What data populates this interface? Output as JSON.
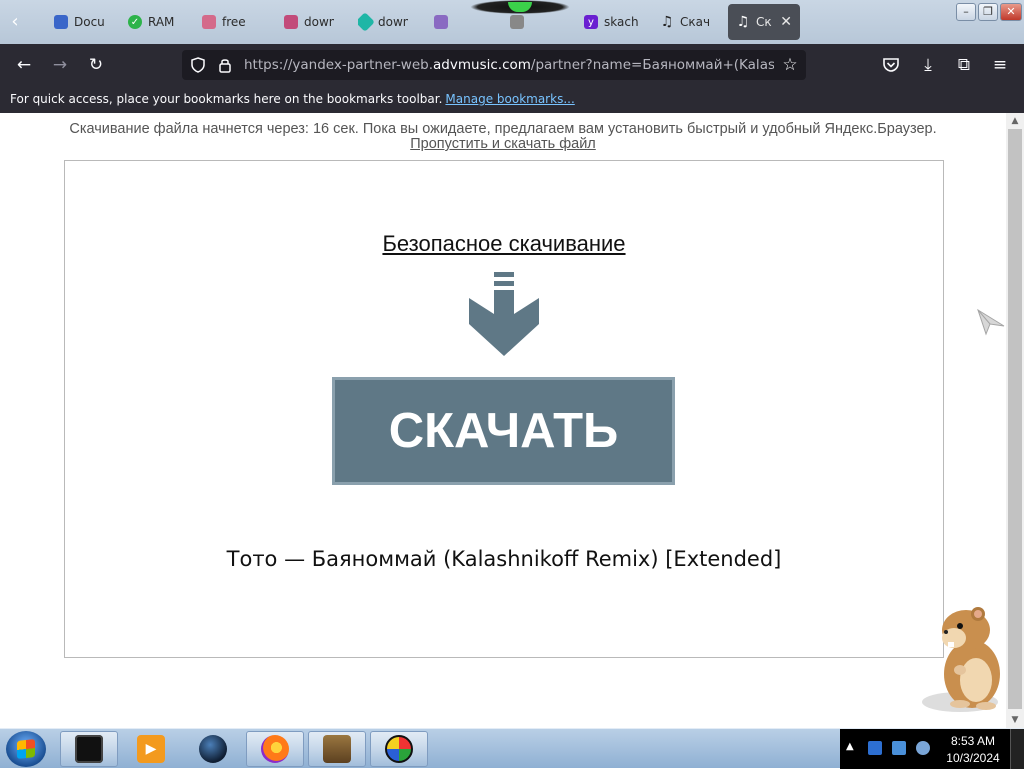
{
  "tabs": [
    {
      "label": "Docu",
      "icon": "document-icon",
      "color": "#3a66c9"
    },
    {
      "label": "RAM",
      "icon": "shield-check-icon",
      "color": "#2db34a"
    },
    {
      "label": "free",
      "icon": "site-icon",
      "color": "#d46a8a"
    },
    {
      "label": "down",
      "icon": "site-icon",
      "color": "#c24b7a"
    },
    {
      "label": "down",
      "icon": "gem-icon",
      "color": "#1fb6a6"
    },
    {
      "label": "",
      "icon": "site-icon",
      "color": "#8a6ac2"
    },
    {
      "label": "",
      "icon": "site-icon",
      "color": "#888888"
    },
    {
      "label": "skach",
      "icon": "yahoo-icon",
      "color": "#6a1fd1"
    },
    {
      "label": "Скач",
      "icon": "music-note-icon",
      "color": "#222222"
    },
    {
      "label": "Ск",
      "icon": "music-note-icon",
      "color": "#222222",
      "active": true
    }
  ],
  "window": {
    "minimize": "–",
    "restore": "❐",
    "close": "✕"
  },
  "nav": {
    "back": "←",
    "forward": "→",
    "reload": "↻",
    "url_prefix": "https://yandex-partner-web.",
    "url_domain": "advmusic.com",
    "url_suffix": "/partner?name=Баяноммай+(Kalashnikoff+",
    "shield": "⛉",
    "lock": "🔒",
    "star": "☆",
    "pocket": "⛉",
    "downloads": "⤓",
    "extensions": "⧉",
    "menu": "≡"
  },
  "bookmarks": {
    "message": "For quick access, place your bookmarks here on the bookmarks toolbar.",
    "manage_link": "Manage bookmarks..."
  },
  "page": {
    "countdown_text": "Скачивание файла начнется через: 16 сек. Пока вы ожидаете, предлагаем вам установить быстрый и удобный Яндекс.Браузер.",
    "skip_link": "Пропустить и скачать файл",
    "safe_download_title": "Безопасное скачивание",
    "download_button": "СКАЧАТЬ",
    "track_name": "Тото — Баяноммай (Kalashnikoff Remix) [Extended]",
    "accent_color": "#5f7886"
  },
  "taskbar": {
    "apps": [
      {
        "name": "terminal-app",
        "color": "#111111"
      },
      {
        "name": "media-player-app",
        "color": "#f39a1e"
      },
      {
        "name": "globe-app",
        "color": "#1d3556"
      },
      {
        "name": "firefox-app",
        "color": "#ff7a18"
      },
      {
        "name": "box-app",
        "color": "#7a5a2a"
      },
      {
        "name": "color-wheel-app",
        "color": "#2aa33a"
      }
    ],
    "time": "8:53 AM",
    "date": "10/3/2024"
  }
}
